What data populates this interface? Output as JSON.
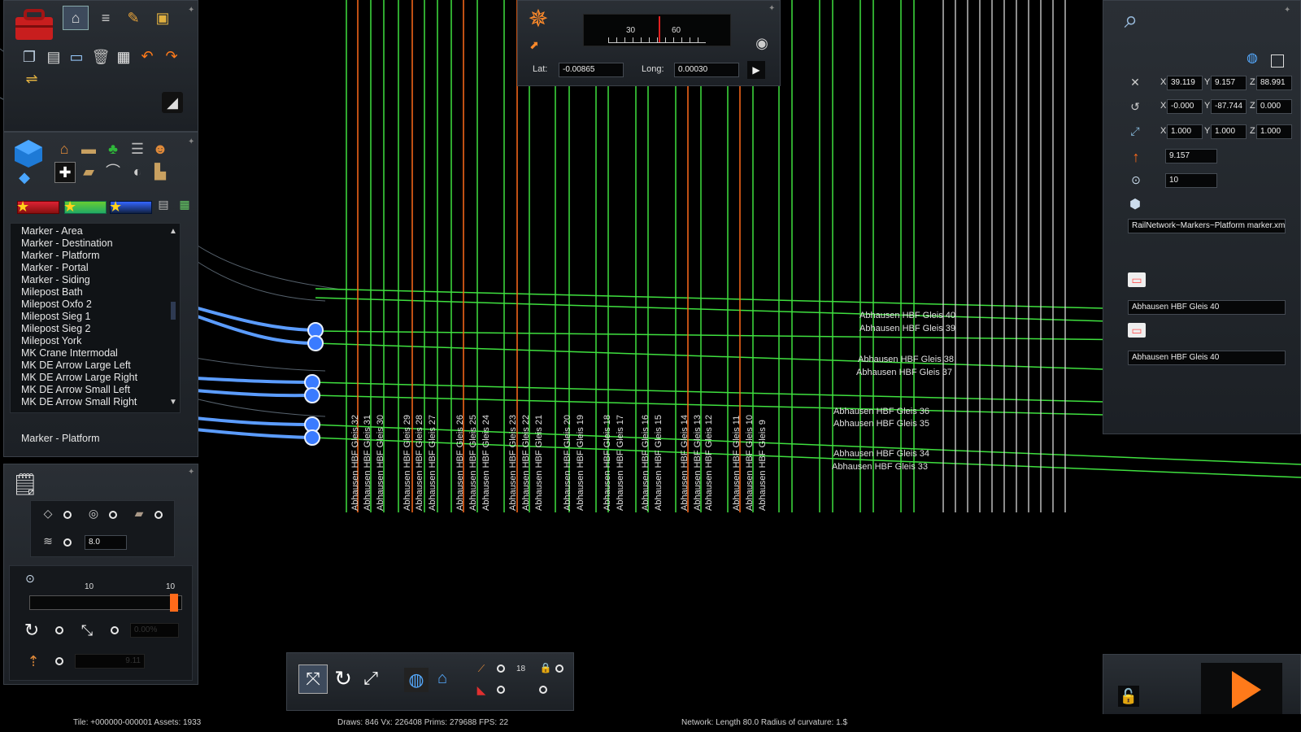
{
  "compass": {
    "tick_30": "30",
    "tick_60": "60",
    "lat_label": "Lat:",
    "lat_value": "-0.00865",
    "long_label": "Long:",
    "long_value": "0.00030"
  },
  "asset_list": {
    "items": [
      "Marker - Area",
      "Marker - Destination",
      "Marker - Platform",
      "Marker - Portal",
      "Marker - Siding",
      "Milepost Bath",
      "Milepost Oxfo 2",
      "Milepost Sieg 1",
      "Milepost Sieg 2",
      "Milepost York",
      "MK Crane Intermodal",
      "MK DE Arrow Large Left",
      "MK DE Arrow Large Right",
      "MK DE Arrow Small Left",
      "MK DE Arrow Small Right"
    ],
    "selected": "Marker - Platform"
  },
  "snap_panel": {
    "value": "8.0"
  },
  "size_panel": {
    "tick_left": "10",
    "tick_right": "10",
    "slider_fraction": 0.98,
    "angle_field": "0.00%",
    "height_field": "9.11"
  },
  "bottom_toolbar": {
    "grid_value": "18"
  },
  "properties": {
    "pos_x": "39.119",
    "pos_y": "9.157",
    "pos_z": "88.991",
    "rot_x": "-0.000",
    "rot_y": "-87.744",
    "rot_z": "0.000",
    "scl_x": "1.000",
    "scl_y": "1.000",
    "scl_z": "1.000",
    "height": "9.157",
    "count": "10",
    "asset_path": "RailNetwork~Markers~Platform marker.xml",
    "platform_name_1": "Abhausen HBF Gleis 40",
    "platform_name_2": "Abhausen HBF Gleis 40",
    "axis_x": "X",
    "axis_y": "Y",
    "axis_z": "Z"
  },
  "horizontal_labels": [
    "Abhausen HBF Gleis 40",
    "Abhausen HBF Gleis 39",
    "Abhausen HBF Gleis 38",
    "Abhausen HBF Gleis 37",
    "Abhausen HBF Gleis 36",
    "Abhausen HBF Gleis 35",
    "Abhausen HBF Gleis 34",
    "Abhausen HBF Gleis 33"
  ],
  "vertical_labels": [
    "Abhausen HBF Gleis 32",
    "Abhausen HBF Gleis 31",
    "Abhausen HBF Gleis 30",
    "Abhausen HBF Gleis 29",
    "Abhausen HBF Gleis 28",
    "Abhausen HBF Gleis 27",
    "Abhausen HBF Gleis 26",
    "Abhausen HBF Gleis 25",
    "Abhausen HBF Gleis 24",
    "Abhausen HBF Gleis 23",
    "Abhausen HBF Gleis 22",
    "Abhausen HBF Gleis 21",
    "Abhausen HBF Gleis 20",
    "Abhausen HBF Gleis 19",
    "Abhausen HBF Gleis 18",
    "Abhausen HBF Gleis 17",
    "Abhausen HBF Gleis 16",
    "Abhausen HBF Gleis 15",
    "Abhausen HBF Gleis 14",
    "Abhausen HBF Gleis 13",
    "Abhausen HBF Gleis 12",
    "Abhausen HBF Gleis 11",
    "Abhausen HBF Gleis 10",
    "Abhausen HBF Gleis 9"
  ],
  "status_bar": {
    "tile": "Tile: +000000-000001  Assets: 1933",
    "draws": "Draws: 846 Vx: 226408 Prims: 279688 FPS: 22",
    "network": "Network:  Length   80.0 Radius of curvature:  1.$"
  },
  "colors": {
    "track_green": "#3fe03f",
    "track_orange": "#ff6a1a",
    "track_white": "#d8d8d8",
    "node_blue": "#3a7bff",
    "accent_orange": "#ff7a1a"
  }
}
